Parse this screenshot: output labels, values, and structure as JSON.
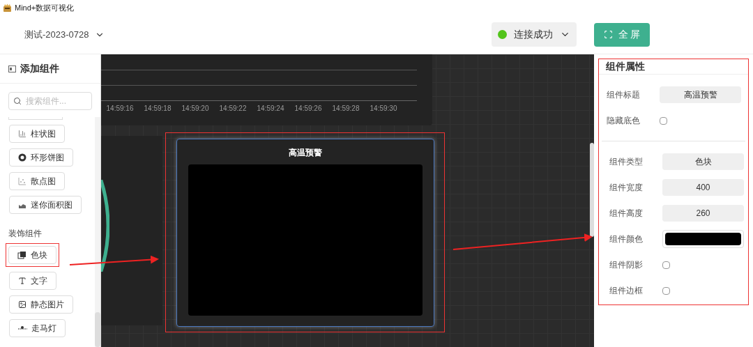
{
  "window": {
    "title": "Mind+数据可视化"
  },
  "header": {
    "project": "测试-2023-0728",
    "connection": {
      "label": "连接成功",
      "connected": true
    },
    "fullscreen": "全 屏"
  },
  "sidebar": {
    "title": "添加组件",
    "search": {
      "placeholder": "搜索组件..."
    },
    "groups": [
      {
        "items": [
          {
            "label": "柱状图",
            "kind": "bar",
            "annotated": false
          },
          {
            "label": "环形饼图",
            "kind": "ring",
            "annotated": false
          },
          {
            "label": "散点图",
            "kind": "scatter",
            "annotated": false
          },
          {
            "label": "迷你面积图",
            "kind": "area",
            "annotated": false
          }
        ]
      },
      {
        "title": "装饰组件",
        "items": [
          {
            "label": "色块",
            "kind": "block",
            "annotated": true
          },
          {
            "label": "文字",
            "kind": "text",
            "annotated": false
          },
          {
            "label": "静态图片",
            "kind": "image",
            "annotated": false
          },
          {
            "label": "走马灯",
            "kind": "marquee",
            "annotated": false
          }
        ]
      }
    ]
  },
  "canvas": {
    "chart_widget": {
      "time_labels": [
        "14:59:16",
        "14:59:18",
        "14:59:20",
        "14:59:22",
        "14:59:24",
        "14:59:26",
        "14:59:28",
        "14:59:30"
      ]
    },
    "selected_widget": {
      "title": "高温预警",
      "annotated": true
    }
  },
  "properties": {
    "title": "组件属性",
    "annotated": true,
    "groups": [
      [
        {
          "label": "组件标题",
          "kind": "text",
          "value": "高温预警"
        },
        {
          "label": "隐藏底色",
          "kind": "checkbox",
          "checked": false
        }
      ],
      [
        {
          "label": "组件类型",
          "kind": "text",
          "value": "色块"
        },
        {
          "label": "组件宽度",
          "kind": "text",
          "value": "400"
        },
        {
          "label": "组件高度",
          "kind": "text",
          "value": "260"
        },
        {
          "label": "组件颜色",
          "kind": "color",
          "color": "#000000"
        },
        {
          "label": "组件阴影",
          "kind": "checkbox",
          "checked": false
        },
        {
          "label": "组件边框",
          "kind": "checkbox",
          "checked": false
        }
      ]
    ]
  }
}
